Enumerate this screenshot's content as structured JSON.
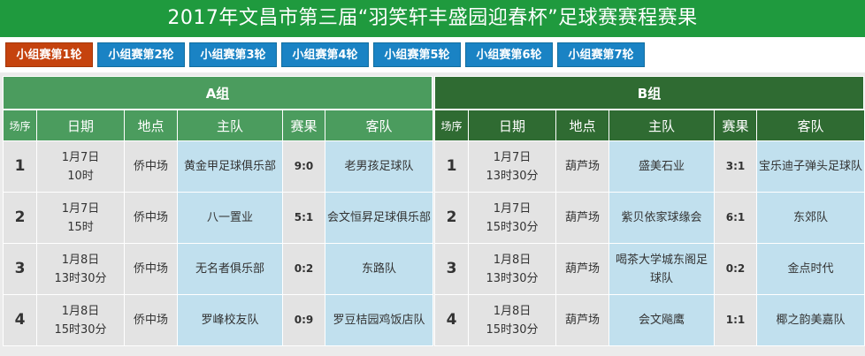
{
  "title": "2017年文昌市第三届“羽笑轩丰盛园迎春杯”足球赛赛程赛果",
  "tabs": [
    {
      "label": "小组赛第1轮",
      "active": true
    },
    {
      "label": "小组赛第2轮",
      "active": false
    },
    {
      "label": "小组赛第3轮",
      "active": false
    },
    {
      "label": "小组赛第4轮",
      "active": false
    },
    {
      "label": "小组赛第5轮",
      "active": false
    },
    {
      "label": "小组赛第6轮",
      "active": false
    },
    {
      "label": "小组赛第7轮",
      "active": false
    }
  ],
  "columns": {
    "seq": "场序",
    "date": "日期",
    "venue": "地点",
    "home": "主队",
    "score": "赛果",
    "away": "客队"
  },
  "groups": [
    {
      "name": "A组",
      "matches": [
        {
          "seq": "1",
          "date": "1月7日",
          "time": "10时",
          "venue": "侨中场",
          "home": "黄金甲足球俱乐部",
          "score": "9:0",
          "away": "老男孩足球队"
        },
        {
          "seq": "2",
          "date": "1月7日",
          "time": "15时",
          "venue": "侨中场",
          "home": "八一置业",
          "score": "5:1",
          "away": "会文恒昇足球俱乐部"
        },
        {
          "seq": "3",
          "date": "1月8日",
          "time": "13时30分",
          "venue": "侨中场",
          "home": "无名者俱乐部",
          "score": "0:2",
          "away": "东路队"
        },
        {
          "seq": "4",
          "date": "1月8日",
          "time": "15时30分",
          "venue": "侨中场",
          "home": "罗峰校友队",
          "score": "0:9",
          "away": "罗豆桔园鸡饭店队"
        }
      ]
    },
    {
      "name": "B组",
      "matches": [
        {
          "seq": "1",
          "date": "1月7日",
          "time": "13时30分",
          "venue": "葫芦场",
          "home": "盛美石业",
          "score": "3:1",
          "away": "宝乐迪子弹头足球队"
        },
        {
          "seq": "2",
          "date": "1月7日",
          "time": "15时30分",
          "venue": "葫芦场",
          "home": "紫贝依家球缘会",
          "score": "6:1",
          "away": "东郊队"
        },
        {
          "seq": "3",
          "date": "1月8日",
          "time": "13时30分",
          "venue": "葫芦场",
          "home": "喝茶大学城东阁足球队",
          "score": "0:2",
          "away": "金点时代"
        },
        {
          "seq": "4",
          "date": "1月8日",
          "time": "15时30分",
          "venue": "葫芦场",
          "home": "会文飚鹰",
          "score": "1:1",
          "away": "椰之韵美嘉队"
        }
      ]
    }
  ]
}
